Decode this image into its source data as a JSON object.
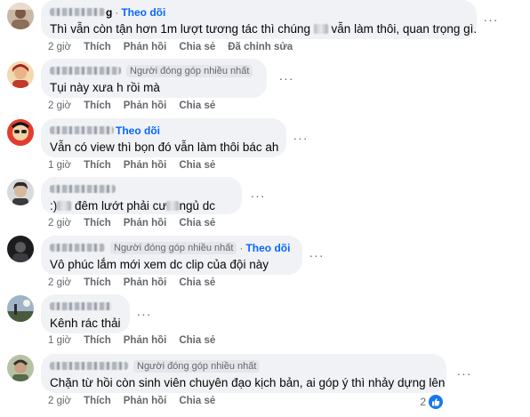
{
  "labels": {
    "follow": "Theo dõi",
    "top_contributor": "Người đóng góp nhiều nhất",
    "like": "Thích",
    "reply": "Phản hồi",
    "share": "Chia sẻ",
    "edited": "Đã chỉnh sửa",
    "dot": "·"
  },
  "comments": [
    {
      "name_tail": "g",
      "time": "2 giờ",
      "text_a": "Thì vẫn còn tận hơn 1m lượt tương tác thì chúng ",
      "text_b": " vẫn làm thôi, quan trọng gì."
    },
    {
      "name_tail": "",
      "time": "2 giờ",
      "text_a": "Tụi này xưa h rồi mà"
    },
    {
      "name_tail": "",
      "time": "1 giờ",
      "text_a": "Vẫn có view thì bọn đó vẫn làm thôi bác ah"
    },
    {
      "name_tail": "",
      "time": "2 giờ",
      "text_a": ":)",
      "text_b": " đêm lướt phải cư",
      "text_c": "ngủ dc"
    },
    {
      "name_tail": "",
      "time": "2 giờ",
      "text_a": "Vô phúc lắm mới xem dc clip của đội này"
    },
    {
      "name_tail": "",
      "time": "1 giờ",
      "text_a": "Kênh rác thải"
    },
    {
      "name_tail": "",
      "time": "2 giờ",
      "text_a": "Chặn từ hồi còn sinh viên chuyên đạo kịch bản, ai góp ý thì nhảy dựng lên",
      "reaction_count": "2"
    }
  ],
  "colors": {
    "accent": "#0866ff",
    "bubble": "#f0f2f5",
    "meta": "#65676b",
    "like_blue": "#1877f2"
  },
  "icons": [
    "more-options-icon",
    "like-reaction-icon"
  ]
}
